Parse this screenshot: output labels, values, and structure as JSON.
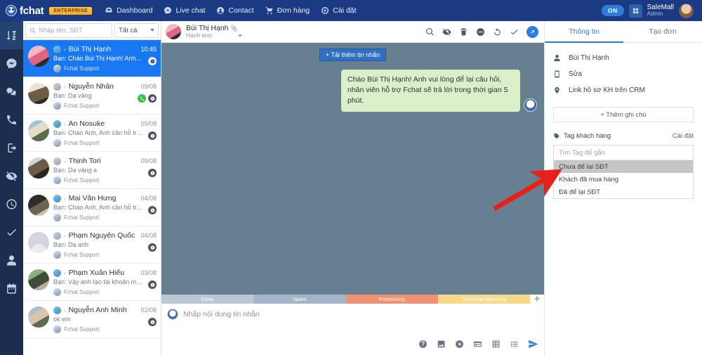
{
  "topnav": {
    "brand": "fchat",
    "enterprise_badge": "ENTERPRISE",
    "items": [
      {
        "label": "Dashboard",
        "icon": "dashboard-icon"
      },
      {
        "label": "Live chat",
        "icon": "messenger-icon"
      },
      {
        "label": "Contact",
        "icon": "user-circle-icon"
      },
      {
        "label": "Đơn hàng",
        "icon": "cart-icon"
      },
      {
        "label": "Cài đặt",
        "icon": "gear-icon"
      }
    ],
    "status_pill": "ON",
    "account_name": "SaleMall",
    "account_role": "Admin"
  },
  "rail": {
    "items": [
      {
        "name": "sort-az-icon",
        "active": true
      },
      {
        "name": "messenger-icon",
        "active": false
      },
      {
        "name": "chats-icon",
        "active": false
      },
      {
        "name": "phone-icon",
        "active": false
      },
      {
        "name": "logout-icon",
        "active": false
      },
      {
        "name": "eye-off-icon",
        "active": false
      },
      {
        "name": "clock-icon",
        "active": false
      },
      {
        "name": "check-icon",
        "active": false
      },
      {
        "name": "person-icon",
        "active": false
      },
      {
        "name": "calendar-icon",
        "active": false
      }
    ]
  },
  "conversations": {
    "search_placeholder": "Nhập tên, SĐT",
    "search_value": "",
    "filter_value": "Tất cả",
    "items": [
      {
        "name": "Bùi Thị Hạnh",
        "time": "10:45",
        "preview": "Bạn: Chào Bùi Thị Hạnh! Anh vu...",
        "tag": "Fchat Support",
        "selected": true,
        "badges": [
          "message"
        ],
        "avatar_class": "a1",
        "source": "fb"
      },
      {
        "name": "Nguyễn Nhân",
        "time": "09/08",
        "preview": "Bạn: Dạ vâng",
        "tag": "Fchat Support",
        "selected": false,
        "badges": [
          "phone",
          "message"
        ],
        "avatar_class": "a2",
        "source": "plain"
      },
      {
        "name": "An Nosuke",
        "time": "09/08",
        "preview": "Bạn: Chào Anh, Anh cần hỗ trợ ...",
        "tag": "Fchat Support",
        "selected": false,
        "badges": [
          "message"
        ],
        "avatar_class": "a3",
        "source": "fb"
      },
      {
        "name": "Thịnh Tori",
        "time": "09/08",
        "preview": "Bạn: Dạ vâng a",
        "tag": "Fchat Support",
        "selected": false,
        "badges": [
          "message"
        ],
        "avatar_class": "a4",
        "source": "plain"
      },
      {
        "name": "Mai Văn Hưng",
        "time": "04/08",
        "preview": "Bạn: Chào Anh, Anh cần hỗ trợ ...",
        "tag": "Fchat Support",
        "selected": false,
        "badges": [
          "message"
        ],
        "avatar_class": "a5",
        "source": "fb"
      },
      {
        "name": "Phạm Nguyên Quốc",
        "time": "04/08",
        "preview": "Bạn: Dạ anh",
        "tag": "Fchat Support",
        "selected": false,
        "badges": [
          "message"
        ],
        "avatar_class": "a6",
        "source": "plain"
      },
      {
        "name": "Phạm Xuân Hiếu",
        "time": "03/08",
        "preview": "Bạn: Vậy anh tạo tài khoản mới...",
        "tag": "Fchat Support",
        "selected": false,
        "badges": [
          "message"
        ],
        "avatar_class": "a7",
        "source": "fb"
      },
      {
        "name": "Nguyễn Anh Minh",
        "time": "02/08",
        "preview": "ok em",
        "tag": "Fchat Support",
        "selected": false,
        "badges": [
          "message"
        ],
        "avatar_class": "a8",
        "source": "fb"
      }
    ]
  },
  "chat": {
    "contact_name": "Bùi Thị Hạnh",
    "contact_sub": "Hạnh test",
    "tools": [
      {
        "name": "search-icon"
      },
      {
        "name": "eye-off-icon"
      },
      {
        "name": "trash-icon"
      },
      {
        "name": "block-icon"
      },
      {
        "name": "history-icon"
      },
      {
        "name": "check-icon"
      },
      {
        "name": "open-external-icon"
      }
    ],
    "load_more": "+ Tải thêm tin nhắn",
    "messages": [
      {
        "from": "agent",
        "text": "Chào Bùi Thị Hạnh! Anh vui lòng để lại câu hỏi, nhân viên hỗ trợ Fchat sẽ trả lời trong thời gian 5 phút."
      }
    ],
    "status_tabs": [
      {
        "label": "Done",
        "color": "#b9c8d4"
      },
      {
        "label": "Spam",
        "color": "#a3b5c6"
      },
      {
        "label": "Processing",
        "color": "#ef9173"
      },
      {
        "label": "Technical reporting",
        "color": "#f6d98a"
      }
    ],
    "add_status": "+",
    "composer_placeholder": "Nhập nội dung tin nhắn",
    "composer_value": "",
    "composer_tools": [
      {
        "name": "help-icon"
      },
      {
        "name": "image-icon"
      },
      {
        "name": "video-icon"
      },
      {
        "name": "card-icon"
      },
      {
        "name": "table-icon"
      },
      {
        "name": "list-icon"
      },
      {
        "name": "send-icon"
      }
    ]
  },
  "right_panel": {
    "tabs": [
      {
        "label": "Thông tin",
        "active": true
      },
      {
        "label": "Tạo đơn",
        "active": false
      }
    ],
    "info_rows": [
      {
        "icon": "person-icon",
        "label": "Bùi Thị Hạnh"
      },
      {
        "icon": "phone-icon",
        "label": "Sửa"
      },
      {
        "icon": "location-pin-icon",
        "label": "Link hồ sơ KH trên CRM"
      }
    ],
    "add_note": "+ Thêm ghi chú",
    "tag_section_label": "Tag khách hàng",
    "tag_settings": "Cài đặt",
    "tag_search_placeholder": "Tìm Tag để gắn",
    "tag_options": [
      {
        "label": "Chưa để lại SĐT",
        "highlighted": true
      },
      {
        "label": "Khách đã mua hàng",
        "highlighted": false
      },
      {
        "label": "Đã để lại SĐT",
        "highlighted": false
      }
    ]
  },
  "annotation": {
    "arrow_color": "#e8201a",
    "points_to": "Chưa để lại SĐT"
  }
}
